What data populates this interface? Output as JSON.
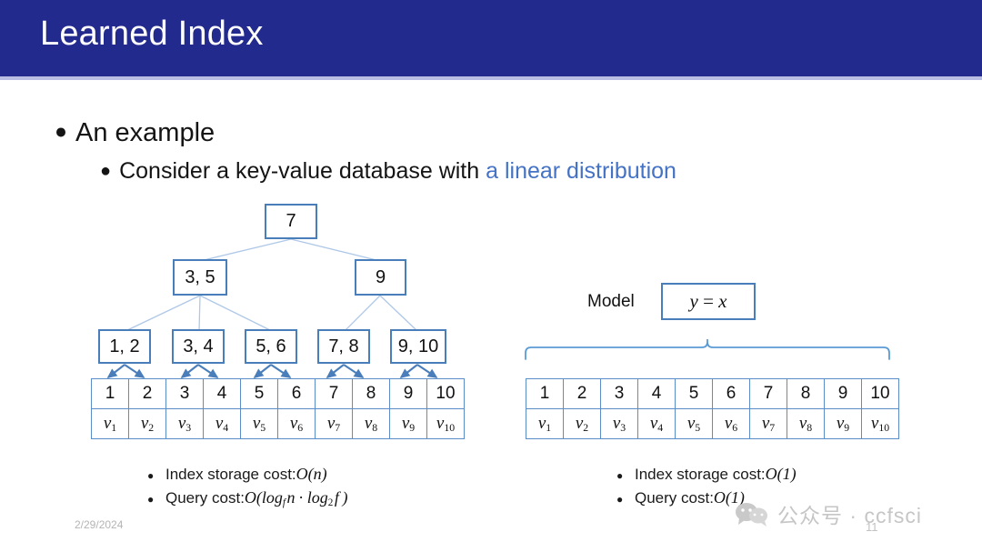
{
  "slide": {
    "title": "Learned Index",
    "title_bar_color": "#232A8E",
    "accent_color": "#4472C4",
    "box_border_color": "#4A7EBB"
  },
  "bullets": {
    "level1": "An example",
    "level2_prefix": "Consider a key-value database with ",
    "level2_highlight": "a linear distribution"
  },
  "btree": {
    "root": "7",
    "internal": [
      "3, 5",
      "9"
    ],
    "leaves": [
      "1, 2",
      "3, 4",
      "5, 6",
      "7, 8",
      "9, 10"
    ]
  },
  "table": {
    "keys": [
      "1",
      "2",
      "3",
      "4",
      "5",
      "6",
      "7",
      "8",
      "9",
      "10"
    ],
    "value_base": "v",
    "value_subscripts": [
      "1",
      "2",
      "3",
      "4",
      "5",
      "6",
      "7",
      "8",
      "9",
      "10"
    ]
  },
  "model": {
    "label": "Model",
    "formula_y": "y",
    "formula_eq": " = ",
    "formula_x": "x"
  },
  "costs": {
    "left": {
      "storage_label": "Index storage cost: ",
      "storage_value_o": "O",
      "storage_value_arg": "(n)",
      "query_label": "Query cost: ",
      "query_value": "O(log_f n · log_2 f)"
    },
    "right": {
      "storage_label": "Index storage cost: ",
      "storage_value": "O(1)",
      "query_label": "Query cost: ",
      "query_value": "O(1)"
    }
  },
  "footer": {
    "date": "2/29/2024",
    "slide_number": "11",
    "watermark_text": "公众号 · ccfsci"
  }
}
